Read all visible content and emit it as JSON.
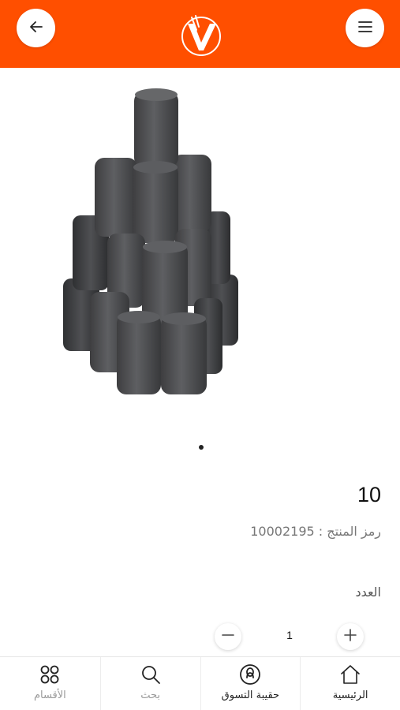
{
  "header": {
    "back_icon": "arrow-left-icon",
    "menu_icon": "hamburger-menu-icon",
    "logo_icon": "brand-v-logo-icon",
    "background_color": "#ff4f00"
  },
  "product": {
    "image_icon": "charcoal-briquettes-image",
    "carousel_dots": 1,
    "price": "10",
    "sku_text": "رمز المنتج : 10002195",
    "quantity_label": "العدد",
    "quantity_value": "1",
    "minus_icon": "minus-icon",
    "plus_icon": "plus-icon"
  },
  "bottom_nav": {
    "items": [
      {
        "label": "الأقسام",
        "icon": "categories-grid-icon"
      },
      {
        "label": "بحث",
        "icon": "search-icon"
      },
      {
        "label": "حقيبة التسوق",
        "icon": "shopping-bag-icon"
      },
      {
        "label": "الرئيسية",
        "icon": "home-icon"
      }
    ]
  }
}
